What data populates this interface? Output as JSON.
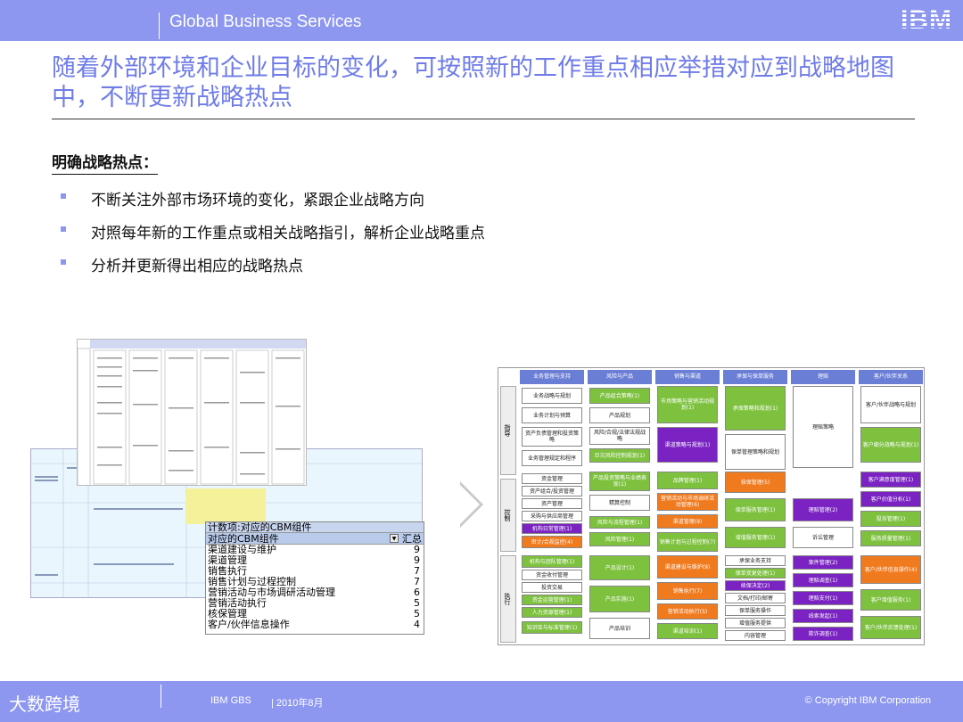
{
  "header": {
    "title": "Global Business Services",
    "logo": "IBM"
  },
  "headline": "随着外部环境和企业目标的变化，可按照新的工作重点相应举措对应到战略地图中，不断更新战略热点",
  "subhead": "明确战略热点：",
  "bullets": [
    "不断关注外部市场环境的变化，紧跟企业战略方向",
    "对照每年新的工作重点或相关战略指引，解析企业战略重点",
    "分析并更新得出相应的战略热点"
  ],
  "pivot": {
    "header": "计数项:对应的CBM组件",
    "subheader": "对应的CBM组件",
    "total_label": "汇总",
    "rows": [
      {
        "label": "渠道建设与维护",
        "value": "9"
      },
      {
        "label": "渠道管理",
        "value": "9"
      },
      {
        "label": "销售执行",
        "value": "7"
      },
      {
        "label": "销售计划与过程控制",
        "value": "7"
      },
      {
        "label": "营销活动与市场调研活动管理",
        "value": "6"
      },
      {
        "label": "营销活动执行",
        "value": "5"
      },
      {
        "label": "核保管理",
        "value": "5"
      },
      {
        "label": "客户/伙伴信息操作",
        "value": "4"
      }
    ]
  },
  "map": {
    "columns": [
      "业务管理与支持",
      "风险与产品",
      "销售与渠道",
      "承保与保单服务",
      "理赔",
      "客户/伙伴关系"
    ],
    "rows": [
      "指导",
      "控制",
      "执行"
    ],
    "colors": {
      "green": "#7dc13f",
      "purple": "#7a22c2",
      "orange": "#f07a1e",
      "white": "#ffffff",
      "header": "#6a7ed6"
    },
    "cells": {
      "c0": [
        "业务战略与规划",
        "业务计划与预算",
        "资产负债管理和投资策略",
        "业务管理规定和程序",
        "资金管理",
        "资产组合/投资管理",
        "资产管理",
        "采购与供应商管理",
        "机构日常管理(1)",
        "审计/合规监控(4)",
        "机构与团队管理(1)",
        "资金收付管理",
        "投资交易",
        "资金运营管理(1)",
        "人力资源管理(1)",
        "知识库与标准管理(1)"
      ],
      "c1": [
        "产品组合策略(1)",
        "产品规划",
        "风险/合规/法律法规战略",
        "巨灾风险控制规划(1)",
        "产品投资策略与业绩表现(1)",
        "精算控制",
        "风险与流程管理(1)",
        "风险管理(1)",
        "产品设计(1)",
        "产品实施(1)",
        "产品培训"
      ],
      "c2": [
        "市场策略与营销活动规划(1)",
        "渠道策略与规划(1)",
        "品牌管理(1)",
        "营销活动与市场调研活动管理(6)",
        "渠道管理(9)",
        "销售计划与过程控制(7)",
        "渠道建设与维护(9)",
        "销售执行(7)",
        "营销活动执行(5)",
        "渠道培训(1)"
      ],
      "c3": [
        "承保策略和规划(1)",
        "保单管理策略和规划",
        "核保管理(5)",
        "保单服务管理(1)",
        "增值服务管理(1)",
        "承保业务支持",
        "保单变更处理(1)",
        "续保决定(2)",
        "文档/打印/邮寄",
        "保单服务操作",
        "增值服务提供",
        "内容管理"
      ],
      "c4": [
        "理赔策略",
        "理赔管理(2)",
        "诉讼管理",
        "案件管理(2)",
        "理赔调查(1)",
        "理赔支付(1)",
        "线索发起(1)",
        "欺诈调查(1)"
      ],
      "c5": [
        "客户/伙伴战略与规划",
        "客户细分战略与规划(1)",
        "客户满意度管理(1)",
        "客户价值分析(1)",
        "投诉管理(1)",
        "服务质量管理(1)",
        "客户/伙伴信息操作(4)",
        "客户增值服务(1)",
        "客户/伙伴反馈处理(1)"
      ]
    }
  },
  "footer": {
    "brand": "大数跨境",
    "gbs": "IBM GBS",
    "date": "| 2010年8月",
    "copyright": "© Copyright IBM Corporation"
  }
}
